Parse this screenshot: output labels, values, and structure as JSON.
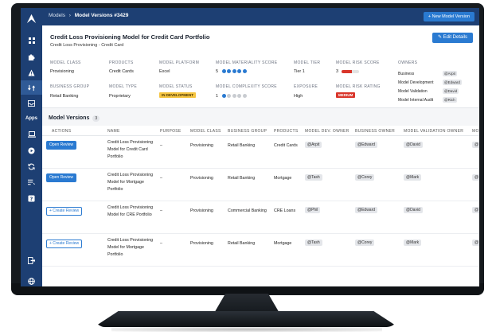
{
  "breadcrumb": {
    "root": "Models",
    "separator": "›",
    "current": "Model Versions #3429"
  },
  "header": {
    "new_button": "+ New Model Version"
  },
  "sidebar": {
    "apps_label": "Apps",
    "icons": [
      "logo-icon",
      "grid-icon",
      "puzzle-icon",
      "warning-icon",
      "swap-icon",
      "inbox-icon",
      "laptop-icon",
      "play-circle-icon",
      "sync-icon",
      "list-icon",
      "help-icon",
      "logout-icon",
      "globe-icon"
    ]
  },
  "model": {
    "title": "Credit Loss Provisioning Model for Credit Card Portfolio",
    "subtitle": "Credit Loss Provisioning - Credit Card",
    "edit_button": "✎ Edit Details",
    "fields": {
      "model_class": {
        "label": "MODEL CLASS",
        "value": "Provisioning"
      },
      "products": {
        "label": "PRODUCTS",
        "value": "Credit Cards"
      },
      "model_platform": {
        "label": "MODEL PLATFORM",
        "value": "Excel"
      },
      "materiality": {
        "label": "MODEL MATERIALITY SCORE",
        "value": "5",
        "score": 5,
        "max": 5
      },
      "tier": {
        "label": "MODEL TIER",
        "value": "Tier 1"
      },
      "risk_score": {
        "label": "MODEL RISK SCORE",
        "value": "3",
        "fraction": 0.6
      },
      "business_group": {
        "label": "BUSINESS GROUP",
        "value": "Retail Banking"
      },
      "model_type": {
        "label": "MODEL TYPE",
        "value": "Proprietary"
      },
      "status": {
        "label": "MODEL STATUS",
        "value": "IN DEVELOPMENT"
      },
      "complexity": {
        "label": "MODEL COMPLEXITY SCORE",
        "value": "1",
        "score": 1,
        "max": 5
      },
      "exposure": {
        "label": "EXPOSURE",
        "value": "High"
      },
      "risk_rating": {
        "label": "MODEL RISK RATING",
        "value": "MEDIUM"
      }
    },
    "owners": {
      "label": "OWNERS",
      "list": [
        {
          "role": "Business",
          "user": "@Arpit"
        },
        {
          "role": "Model Development",
          "user": "@Edward"
        },
        {
          "role": "Model Validation",
          "user": "@David"
        },
        {
          "role": "Model Internal Audit",
          "user": "@Rich"
        }
      ]
    }
  },
  "versions": {
    "title": "Model Versions",
    "count": "3",
    "columns": [
      "ACTIONS",
      "NAME",
      "PURPOSE",
      "MODEL CLASS",
      "BUSINESS GROUP",
      "PRODUCTS",
      "MODEL DEV. OWNER",
      "BUSINESS OWNER",
      "MODEL VALIDATION OWNER",
      "MO"
    ],
    "rows": [
      {
        "action": "Open Review",
        "action_type": "open",
        "name": "Credit Loss Provisioning Model for Credit Card Portfolio",
        "purpose": "–",
        "model_class": "Provisioning",
        "business_group": "Retail Banking",
        "products": "Credit Cards",
        "dev_owner": "@Arpit",
        "business_owner": "@Edward",
        "validation_owner": "@David",
        "mo": "@"
      },
      {
        "action": "Open Review",
        "action_type": "open",
        "name": "Credit Loss Provisioning Model for Mortgage Portfolio",
        "purpose": "–",
        "model_class": "Provisioning",
        "business_group": "Retail Banking",
        "products": "Mortgage",
        "dev_owner": "@Tash",
        "business_owner": "@Corey",
        "validation_owner": "@Mark",
        "mo": "@"
      },
      {
        "action": "+ Create Review",
        "action_type": "create",
        "name": "Credit Loss Provisioning Model for CRE Portfolio",
        "purpose": "–",
        "model_class": "Provisioning",
        "business_group": "Commercial Banking",
        "products": "CRE Loans",
        "dev_owner": "@Phil",
        "business_owner": "@Edward",
        "validation_owner": "@David",
        "mo": "@"
      },
      {
        "action": "+ Create Review",
        "action_type": "create",
        "name": "Credit Loss Provisioning Model for Mortgage Portfolio",
        "purpose": "–",
        "model_class": "Provisioning",
        "business_group": "Retail Banking",
        "products": "Mortgage",
        "dev_owner": "@Tash",
        "business_owner": "@Corey",
        "validation_owner": "@Mark",
        "mo": "@"
      }
    ]
  },
  "colors": {
    "sidebar": "#1d3f73",
    "accent": "#2a7ad1",
    "dot_on": "#2a7ad1",
    "dot_off": "#c9ccd1",
    "status_dev": "#f5c542",
    "risk_medium": "#d9362b"
  }
}
